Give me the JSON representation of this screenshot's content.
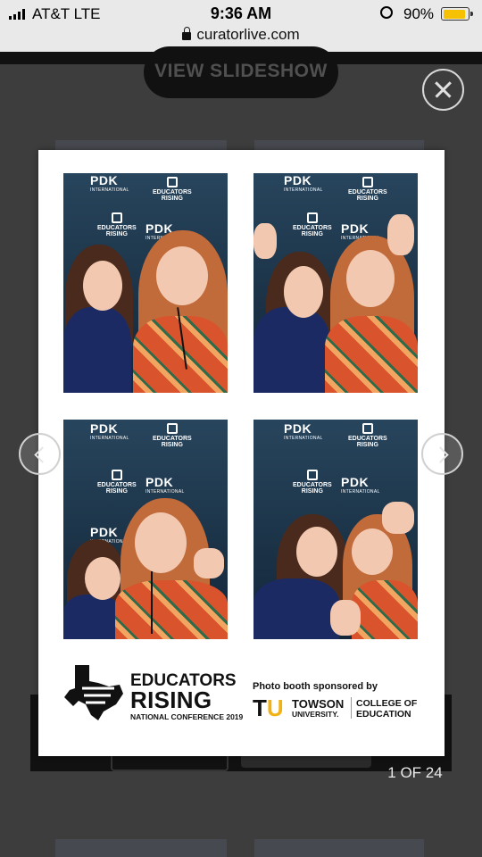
{
  "status_bar": {
    "carrier": "AT&T  LTE",
    "time": "9:36 AM",
    "battery_percent": "90%",
    "battery_level": 0.9,
    "url": "curatorlive.com"
  },
  "viewer": {
    "slideshow_button": "VIEW SLIDESHOW",
    "close_icon": "close-icon",
    "prev_icon": "chevron-left-icon",
    "next_icon": "chevron-right-icon",
    "counter": "1 OF 24"
  },
  "photo_strip": {
    "backdrop_logo_pdk": "PDK",
    "backdrop_logo_pdk_sub": "INTERNATIONAL",
    "backdrop_logo_er_line1": "EDUCATORS",
    "backdrop_logo_er_line2": "RISING",
    "branding": {
      "line1": "EDUCATORS",
      "line2": "RISING",
      "line3": "NATIONAL CONFERENCE 2019"
    },
    "sponsor": {
      "label": "Photo booth sponsored by",
      "tu_letters": "TU",
      "university_name": "TOWSON",
      "university_sub": "UNIVERSITY.",
      "college_line1": "COLLEGE OF",
      "college_line2": "EDUCATION"
    }
  },
  "colors": {
    "overlay": "#3d3d3d",
    "card": "#ffffff",
    "battery": "#f5c100",
    "towson_gold": "#f3b213",
    "backdrop": "#1f3a4f"
  }
}
